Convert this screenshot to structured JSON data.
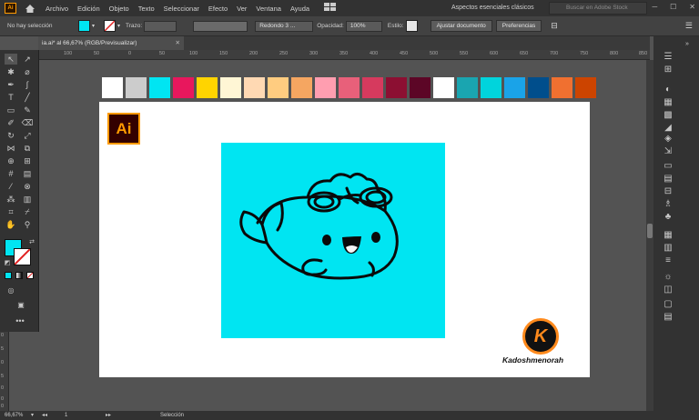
{
  "app": {
    "badge": "Ai"
  },
  "menu": [
    "Archivo",
    "Edición",
    "Objeto",
    "Texto",
    "Seleccionar",
    "Efecto",
    "Ver",
    "Ventana",
    "Ayuda"
  ],
  "workspace": "Aspectos esenciales clásicos",
  "search_placeholder": "Buscar en Adobe Stock",
  "control": {
    "selection": "No hay selección",
    "fill_color": "#00e5f2",
    "stroke_label": "Trazo:",
    "brush": "Redondo 3 ...",
    "opacity_label": "Opacidad:",
    "opacity_value": "100%",
    "style_label": "Estilo:",
    "align_button": "Ajustar documento",
    "prefs_button": "Preferencias"
  },
  "tab": {
    "title": "ia.ai* al 66,67% (RGB/Previsualizar)"
  },
  "ruler_h": [
    "100",
    "50",
    "0",
    "50",
    "100",
    "150",
    "200",
    "250",
    "300",
    "350",
    "400",
    "450",
    "500",
    "550",
    "600",
    "650",
    "700",
    "750",
    "800",
    "850"
  ],
  "ruler_v": [
    "0",
    "5",
    "0",
    "5",
    "0",
    "0",
    "0"
  ],
  "palette": [
    "#ffffff",
    "#cccccc",
    "#00e5f2",
    "#e8175d",
    "#ffd400",
    "#fff6d5",
    "#ffd9b3",
    "#ffcc80",
    "#f5a661",
    "#ff9eb0",
    "#e8607a",
    "#d63a5e",
    "#8c0f32",
    "#5c0626",
    "#ffffff",
    "#1aa5b0",
    "#00d4dc",
    "#1aa3e8",
    "#004e8c",
    "#f07030",
    "#cc4400"
  ],
  "logo": {
    "text": "Ai"
  },
  "brand": {
    "letter": "K",
    "name": "Kadoshmenorah"
  },
  "status": {
    "zoom": "66,67%",
    "page": "1",
    "tool": "Selección"
  }
}
